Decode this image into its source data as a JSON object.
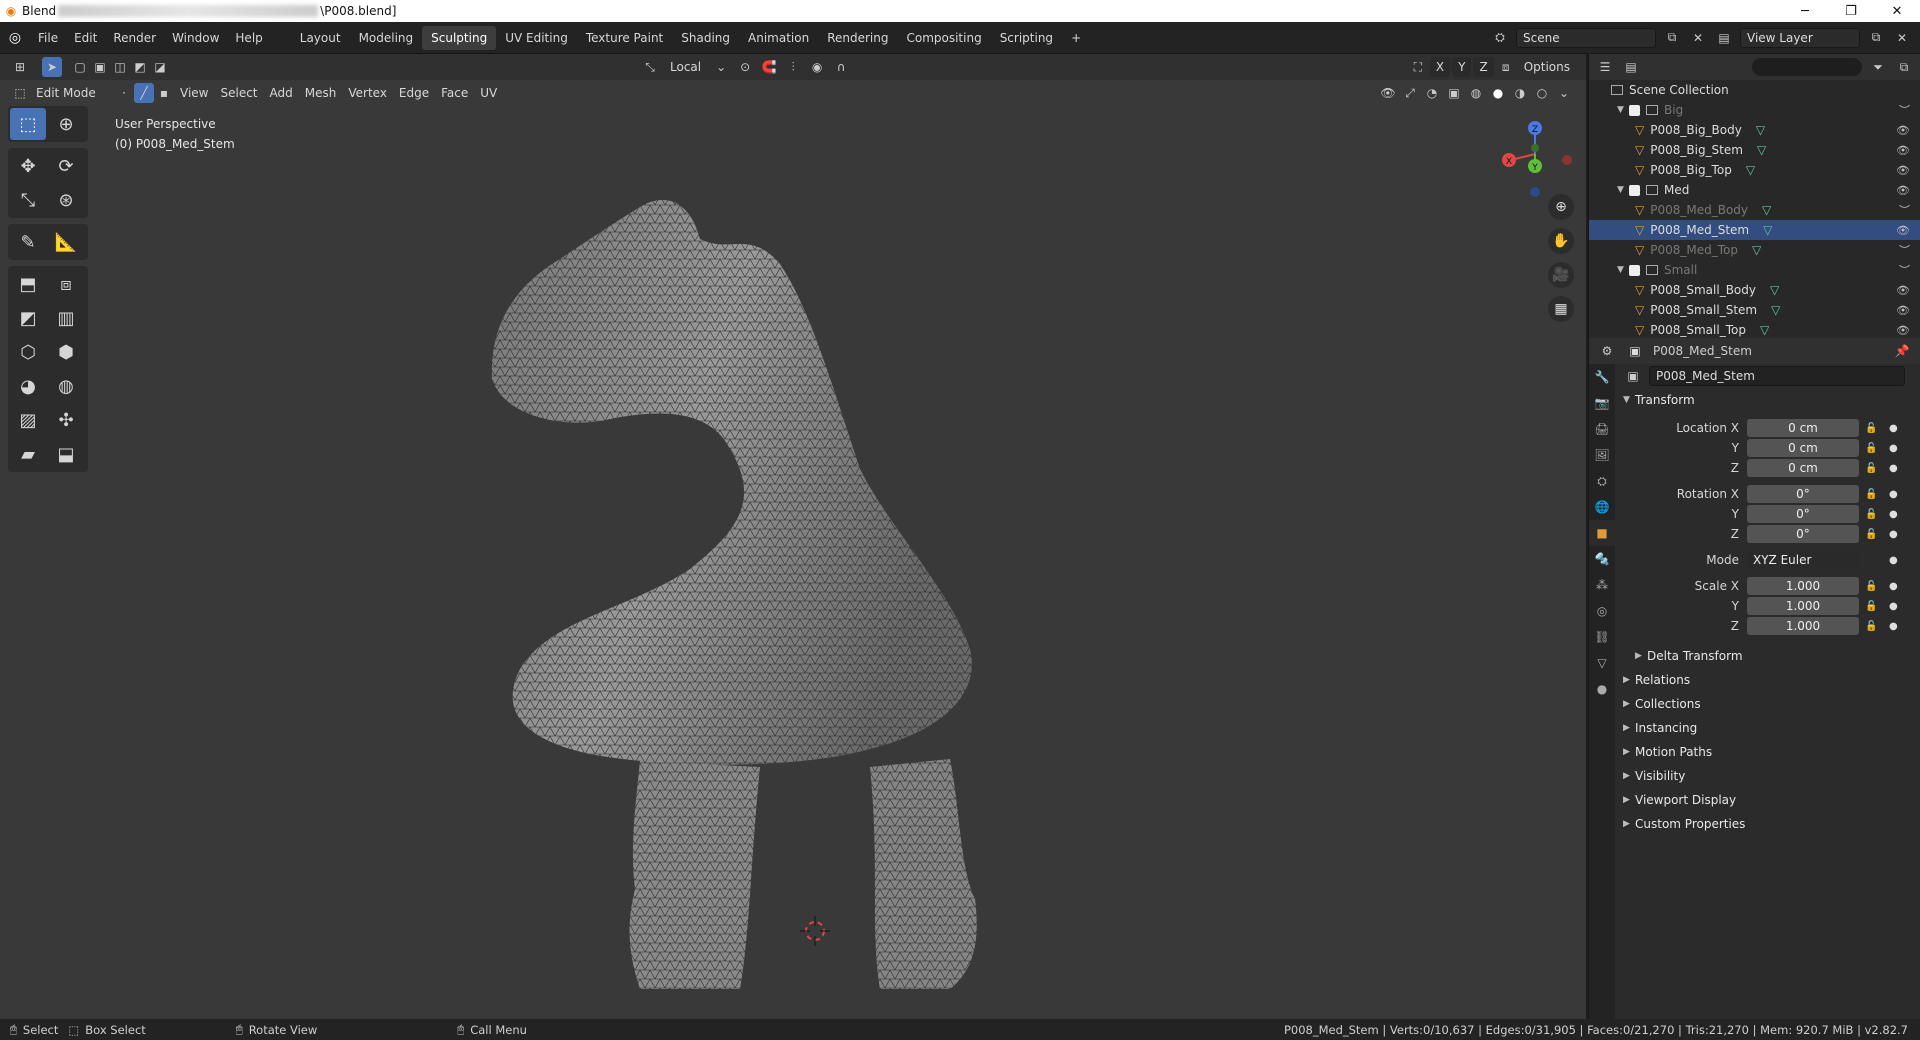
{
  "title_bar": {
    "prefix": "Blend",
    "file": "\\P008.blend]",
    "minimize": "─",
    "maximize": "❐",
    "close": "✕"
  },
  "menus": [
    "File",
    "Edit",
    "Render",
    "Window",
    "Help"
  ],
  "workspaces": [
    "Layout",
    "Modeling",
    "Sculpting",
    "UV Editing",
    "Texture Paint",
    "Shading",
    "Animation",
    "Rendering",
    "Compositing",
    "Scripting"
  ],
  "active_workspace": "Sculpting",
  "workspace_add": "+",
  "scene": {
    "label": "Scene",
    "view_layer": "View Layer"
  },
  "viewport_header": {
    "transform_orientation": "Local",
    "axes": [
      "X",
      "Y",
      "Z"
    ],
    "options": "Options"
  },
  "viewport_header2": {
    "mode": "Edit Mode",
    "menus": [
      "View",
      "Select",
      "Add",
      "Mesh",
      "Vertex",
      "Edge",
      "Face",
      "UV"
    ]
  },
  "viewport_overlay_text": {
    "perspective": "User Perspective",
    "object": "(0) P008_Med_Stem"
  },
  "gizmo": {
    "x": "X",
    "y": "Y",
    "z": "Z"
  },
  "outliner": {
    "root": "Scene Collection",
    "rows": [
      {
        "type": "collection",
        "label": "Big",
        "dim": true
      },
      {
        "type": "object",
        "label": "P008_Big_Body"
      },
      {
        "type": "object",
        "label": "P008_Big_Stem"
      },
      {
        "type": "object",
        "label": "P008_Big_Top"
      },
      {
        "type": "collection",
        "label": "Med"
      },
      {
        "type": "object",
        "label": "P008_Med_Body",
        "dim": true
      },
      {
        "type": "object",
        "label": "P008_Med_Stem",
        "selected": true
      },
      {
        "type": "object",
        "label": "P008_Med_Top",
        "dim": true
      },
      {
        "type": "collection",
        "label": "Small",
        "dim": true
      },
      {
        "type": "object",
        "label": "P008_Small_Body"
      },
      {
        "type": "object",
        "label": "P008_Small_Stem"
      },
      {
        "type": "object",
        "label": "P008_Small_Top"
      }
    ]
  },
  "properties": {
    "header_object": "P008_Med_Stem",
    "object_name": "P008_Med_Stem",
    "transform_label": "Transform",
    "location": {
      "label_x": "Location X",
      "x": "0 cm",
      "y": "0 cm",
      "z": "0 cm"
    },
    "rotation": {
      "label_x": "Rotation X",
      "x": "0°",
      "y": "0°",
      "z": "0°"
    },
    "mode": {
      "label": "Mode",
      "value": "XYZ Euler"
    },
    "scale": {
      "label_x": "Scale X",
      "x": "1.000",
      "y": "1.000",
      "z": "1.000"
    },
    "axis_y": "Y",
    "axis_z": "Z",
    "delta_transform": "Delta Transform",
    "panels": [
      "Relations",
      "Collections",
      "Instancing",
      "Motion Paths",
      "Visibility",
      "Viewport Display",
      "Custom Properties"
    ]
  },
  "statusbar": {
    "select": "Select",
    "box_select": "Box Select",
    "rotate_view": "Rotate View",
    "call_menu": "Call Menu",
    "stats": "P008_Med_Stem | Verts:0/10,637 | Edges:0/31,905 | Faces:0/21,270 | Tris:21,270 | Mem: 920.7 MiB | v2.82.7"
  }
}
